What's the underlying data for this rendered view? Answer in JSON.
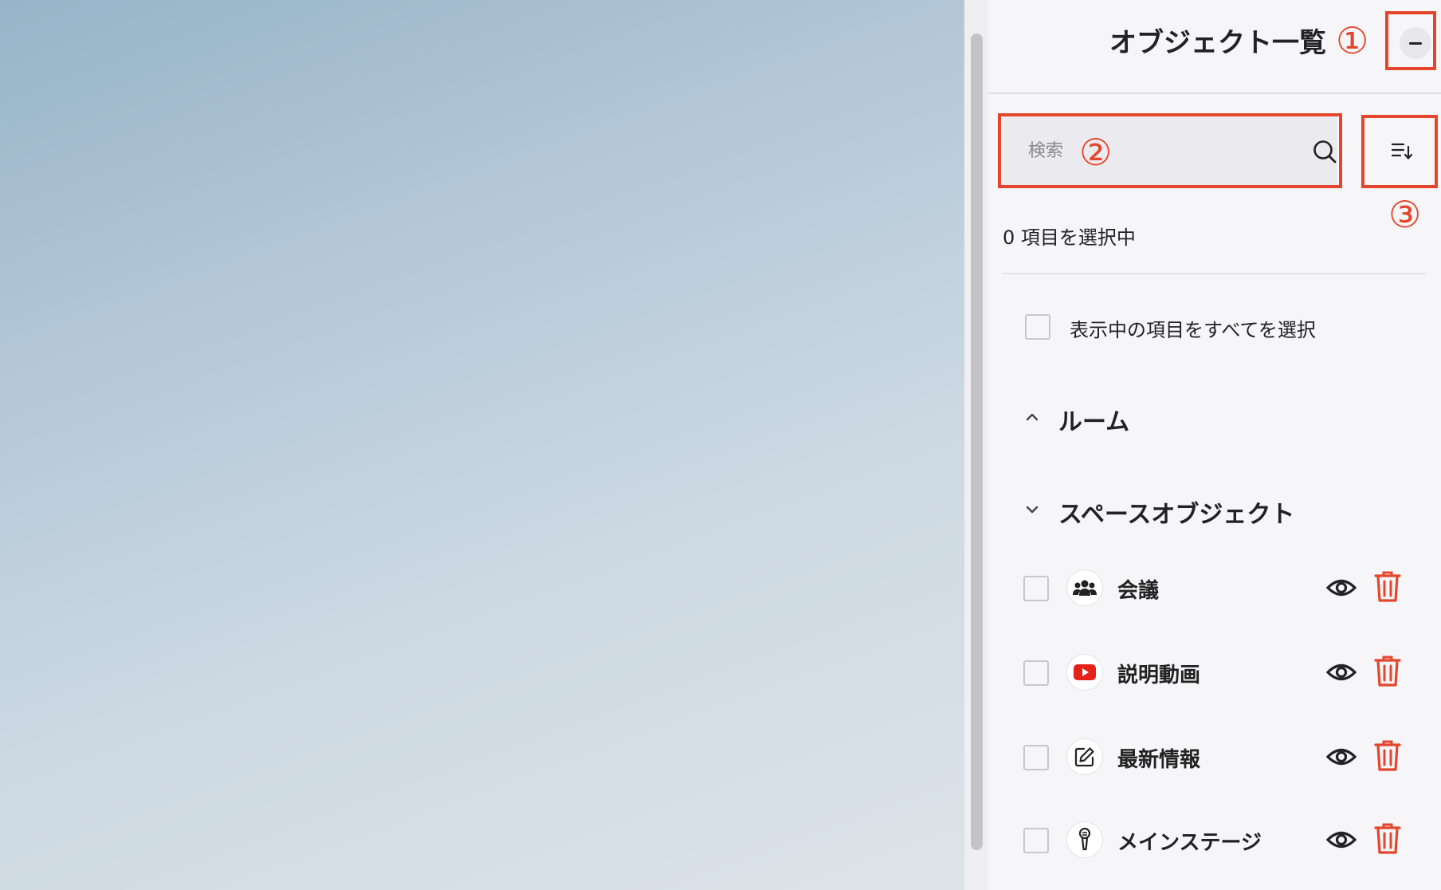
{
  "panel": {
    "title": "オブジェクト一覧",
    "collapse_label": "−",
    "markers": [
      "①",
      "②",
      "③"
    ],
    "search": {
      "placeholder": "検索",
      "value": ""
    },
    "selected_count_text": "0 項目を選択中",
    "select_all_label": "表示中の項目をすべてを選択",
    "groups": [
      {
        "label": "ルーム",
        "expanded": true
      },
      {
        "label": "スペースオブジェクト",
        "expanded": false
      }
    ],
    "items": [
      {
        "name": "会議",
        "icon": "people-icon"
      },
      {
        "name": "説明動画",
        "icon": "youtube-icon"
      },
      {
        "name": "最新情報",
        "icon": "edit-note-icon"
      },
      {
        "name": "メインステージ",
        "icon": "microphone-icon"
      }
    ]
  },
  "colors": {
    "annotation_red": "#e5452c",
    "delete_red": "#e5452c",
    "youtube_red": "#e62117",
    "panel_bg": "#f6f6f8"
  }
}
